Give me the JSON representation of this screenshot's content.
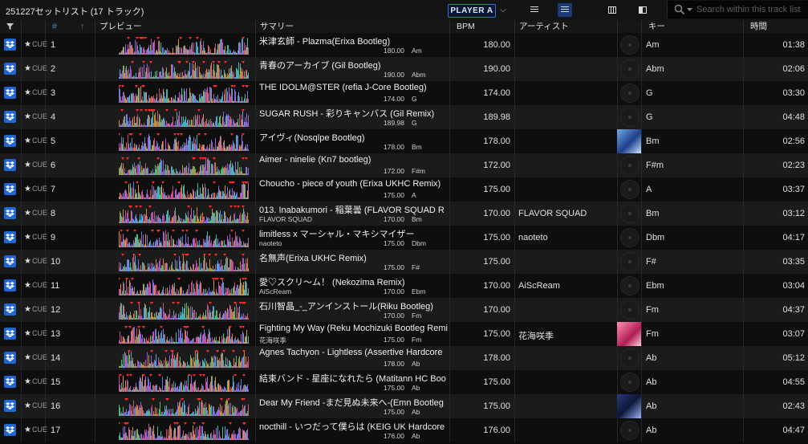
{
  "app": {
    "playlist_title": "251227セットリスト (17 トラック)",
    "player_button": "PLAYER A",
    "player_caret": "⌵",
    "search_placeholder": "Search within this track list"
  },
  "toolbar": {
    "icons": [
      "list-view-icon",
      "compact-list-view-icon",
      "column-view-icon",
      "split-view-icon"
    ]
  },
  "columns": {
    "filter": "",
    "num": "#",
    "sort_arrow": "↑",
    "preview": "プレビュー",
    "summary": "サマリー",
    "bpm": "BPM",
    "artist": "アーティスト",
    "key": "キー",
    "time": "時間"
  },
  "row_labels": {
    "star": "★",
    "cue": "CUE"
  },
  "colors": {
    "accent": "#1f66d8",
    "sort_arrow": "#4f7fe0"
  },
  "tracks": [
    {
      "num": "1",
      "title": "米津玄師 - Plazma(Erixa Bootleg)",
      "sub": "",
      "bpm_small": "180.00",
      "key_small": "Am",
      "bpm": "180.00",
      "artist": "",
      "art": "disc",
      "key": "Am",
      "time": "01:38"
    },
    {
      "num": "2",
      "title": "青春のアーカイブ (Gil Bootleg)",
      "sub": "",
      "bpm_small": "190.00",
      "key_small": "Abm",
      "bpm": "190.00",
      "artist": "",
      "art": "disc",
      "key": "Abm",
      "time": "02:06"
    },
    {
      "num": "3",
      "title": "THE IDOLM@STER (refia J-Core Bootleg)",
      "sub": "",
      "bpm_small": "174.00",
      "key_small": "G",
      "bpm": "174.00",
      "artist": "",
      "art": "disc",
      "key": "G",
      "time": "03:30"
    },
    {
      "num": "4",
      "title": "SUGAR RUSH - 彩りキャンバス (Gil Remix)",
      "sub": "",
      "bpm_small": "189.98",
      "key_small": "G",
      "bpm": "189.98",
      "artist": "",
      "art": "disc",
      "key": "G",
      "time": "04:48"
    },
    {
      "num": "5",
      "title": "アイヴィ(Nosqlpe Bootleg)",
      "sub": "",
      "bpm_small": "178.00",
      "key_small": "Bm",
      "bpm": "178.00",
      "artist": "",
      "art": "cover-blue",
      "key": "Bm",
      "time": "02:56"
    },
    {
      "num": "6",
      "title": "Aimer - ninelie (Kn7 bootleg)",
      "sub": "",
      "bpm_small": "172.00",
      "key_small": "F#m",
      "bpm": "172.00",
      "artist": "",
      "art": "disc",
      "key": "F#m",
      "time": "02:23"
    },
    {
      "num": "7",
      "title": "Choucho - piece of youth (Erixa UKHC Remix)",
      "sub": "",
      "bpm_small": "175.00",
      "key_small": "A",
      "bpm": "175.00",
      "artist": "",
      "art": "disc",
      "key": "A",
      "time": "03:37"
    },
    {
      "num": "8",
      "title": "013. Inabakumori - 稲葉曇 (FLAVOR SQUAD R",
      "sub": "FLAVOR SQUAD",
      "bpm_small": "170.00",
      "key_small": "Bm",
      "bpm": "170.00",
      "artist": "FLAVOR SQUAD",
      "art": "disc",
      "key": "Bm",
      "time": "03:12"
    },
    {
      "num": "9",
      "title": "limitless x マーシャル・マキシマイザー",
      "sub": "naoteto",
      "bpm_small": "175.00",
      "key_small": "Dbm",
      "bpm": "175.00",
      "artist": "naoteto",
      "art": "disc",
      "key": "Dbm",
      "time": "04:17"
    },
    {
      "num": "10",
      "title": "名無声(Erixa UKHC Remix)",
      "sub": "",
      "bpm_small": "175.00",
      "key_small": "F#",
      "bpm": "175.00",
      "artist": "",
      "art": "disc",
      "key": "F#",
      "time": "03:35"
    },
    {
      "num": "11",
      "title": "愛♡スクリ～ム！ (Nekozima Remix)",
      "sub": "AiScReam",
      "bpm_small": "170.00",
      "key_small": "Ebm",
      "bpm": "170.00",
      "artist": "AiScReam",
      "art": "disc",
      "key": "Ebm",
      "time": "03:04"
    },
    {
      "num": "12",
      "title": "石川智晶_-_アンインストール(Riku Bootleg)",
      "sub": "",
      "bpm_small": "170.00",
      "key_small": "Fm",
      "bpm": "170.00",
      "artist": "",
      "art": "disc",
      "key": "Fm",
      "time": "04:37"
    },
    {
      "num": "13",
      "title": "Fighting My Way (Reku Mochizuki Bootleg Remi",
      "sub": "花海咲季",
      "bpm_small": "175.00",
      "key_small": "Fm",
      "bpm": "175.00",
      "artist": "花海咲季",
      "art": "cover-pink",
      "key": "Fm",
      "time": "03:07"
    },
    {
      "num": "14",
      "title": "Agnes Tachyon - Lightless (Assertive Hardcore",
      "sub": "",
      "bpm_small": "178.00",
      "key_small": "Ab",
      "bpm": "178.00",
      "artist": "",
      "art": "disc",
      "key": "Ab",
      "time": "05:12"
    },
    {
      "num": "15",
      "title": "結束バンド - 星座になれたら (Matitann HC Boo",
      "sub": "",
      "bpm_small": "175.00",
      "key_small": "Ab",
      "bpm": "175.00",
      "artist": "",
      "art": "disc",
      "key": "Ab",
      "time": "04:55"
    },
    {
      "num": "16",
      "title": "Dear My Friend -まだ見ぬ未来へ-(Emn Bootleg",
      "sub": "",
      "bpm_small": "175.00",
      "key_small": "Ab",
      "bpm": "175.00",
      "artist": "",
      "art": "cover-navy",
      "key": "Ab",
      "time": "02:43"
    },
    {
      "num": "17",
      "title": "nocthill - いつだって僕らは (KEIG UK Hardcore",
      "sub": "",
      "bpm_small": "176.00",
      "key_small": "Ab",
      "bpm": "176.00",
      "artist": "",
      "art": "disc",
      "key": "Ab",
      "time": "04:47"
    }
  ]
}
